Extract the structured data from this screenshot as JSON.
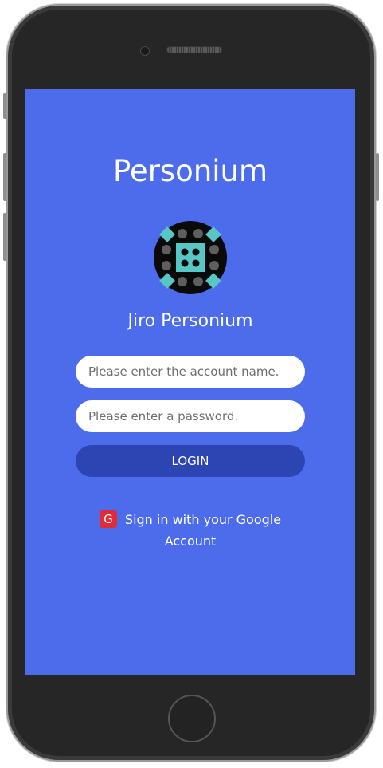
{
  "app": {
    "title": "Personium"
  },
  "profile": {
    "display_name": "Jiro Personium",
    "avatar_icon": "personium-unit-icon"
  },
  "login_form": {
    "account_placeholder": "Please enter the account name.",
    "account_value": "",
    "password_placeholder": "Please enter a password.",
    "password_value": "",
    "login_label": "LOGIN"
  },
  "google_signin": {
    "icon_letter": "G",
    "label": "Sign in with your Google Account",
    "icon_color": "#e12b36"
  },
  "theme": {
    "background": "#4c6cec",
    "button_color": "#2c45b2"
  }
}
